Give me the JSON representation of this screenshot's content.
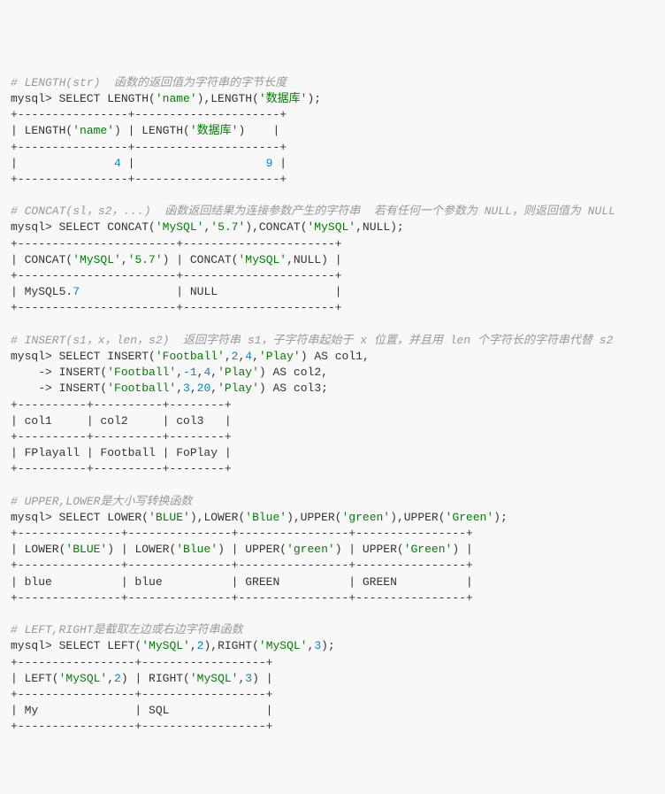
{
  "c1": "# LENGTH(str)  函数的返回值为字符串的字节长度",
  "p1": "mysql> ",
  "k1": "SELECT",
  "s1a": "'name'",
  "s1b": "'数据库'",
  "r1_sep": "+----------------+---------------------+",
  "r1_h": "| LENGTH('name') | LENGTH('数据库')    |",
  "h1_a": "'name'",
  "h1_b": "'数据库'",
  "r1_d1a": "4",
  "r1_d1b": "9",
  "r1_row": "|              4 |                   9 |",
  "c2": "# CONCAT(sl，s2，...)  函数返回结果为连接参数产生的字符串  若有任何一个参数为 NULL，则返回值为 NULL",
  "s2a": "'MySQL'",
  "s2b": "'5.7'",
  "r2_sep": "+-----------------------+----------------------+",
  "h2_a": "'MySQL'",
  "h2_b": "'5.7'",
  "h2_c": "'MySQL'",
  "r2_d1a": "MySQL5.7",
  "r2_d1b": "NULL",
  "r2_row": "| MySQL5.7              | NULL                 |",
  "r2_7num": "7",
  "c3": "# INSERT(s1，x，len，s2)  返回字符串 s1，子字符串起始于 x 位置，并且用 len 个字符长的字符串代替 s2",
  "s3a": "'Football'",
  "n3_2": "2",
  "n3_4": "4",
  "s3b": "'Play'",
  "n3_m1": "-1",
  "n3_3": "3",
  "n3_20": "20",
  "r3_sep": "+----------+----------+--------+",
  "r3_h": "| col1     | col2     | col3   |",
  "r3_row": "| FPlayall | Football | FoPlay |",
  "c4": "# UPPER,LOWER是大小写转换函数",
  "s4a": "'BLUE'",
  "s4b": "'Blue'",
  "s4c": "'green'",
  "s4d": "'Green'",
  "r4_sep": "+---------------+---------------+----------------+----------------+",
  "r4_row": "| blue          | blue          | GREEN          | GREEN          |",
  "c5": "# LEFT,RIGHT是截取左边或右边字符串函数",
  "s5a": "'MySQL'",
  "n5_2": "2",
  "n5_3": "3",
  "r5_sep": "+-----------------+------------------+",
  "r5_row": "| My              | SQL              |",
  "r5_last": "+-----------------+------------------+"
}
